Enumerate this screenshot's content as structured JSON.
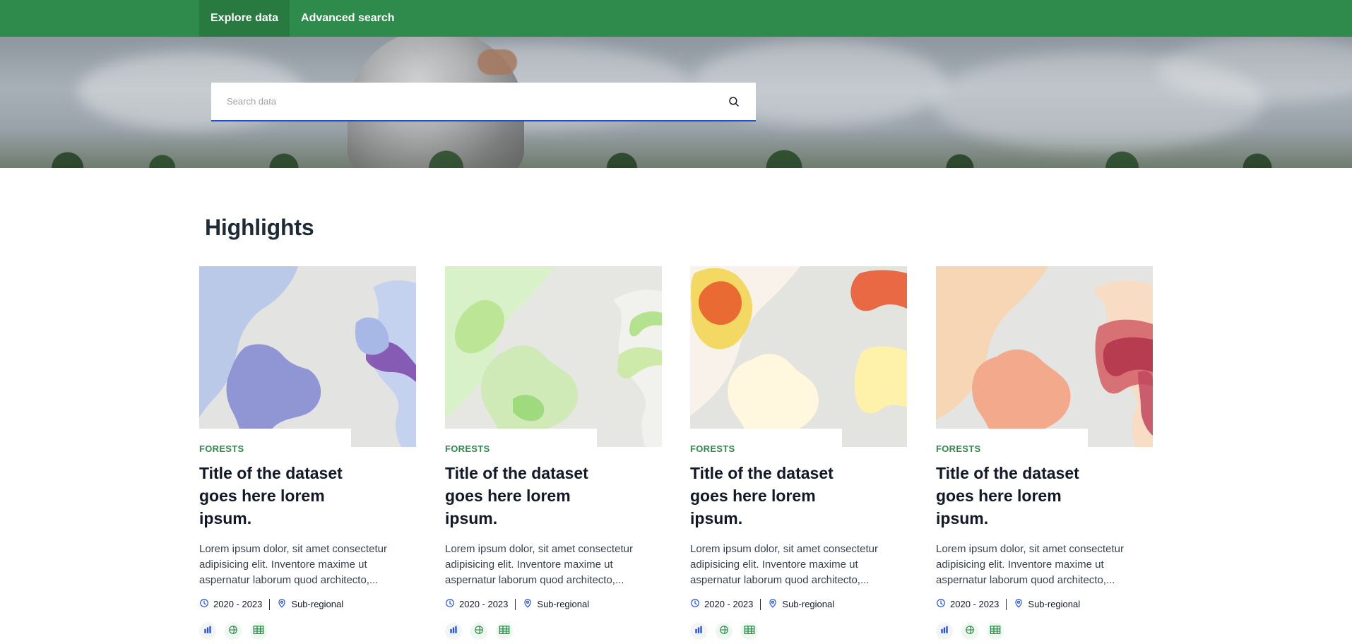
{
  "nav": {
    "items": [
      {
        "label": "Explore data",
        "active": true
      },
      {
        "label": "Advanced search",
        "active": false
      }
    ]
  },
  "search": {
    "placeholder": "Search data"
  },
  "highlights": {
    "title": "Highlights",
    "cards": [
      {
        "category": "FORESTS",
        "title": "Title of the dataset goes here lorem ipsum.",
        "description": "Lorem ipsum dolor, sit amet consectetur adipisicing elit. Inventore maxime ut aspernatur laborum quod architecto,...",
        "period": "2020 - 2023",
        "scope": "Sub-regional",
        "map_style": "blue-purple"
      },
      {
        "category": "FORESTS",
        "title": "Title of the dataset goes here lorem ipsum.",
        "description": "Lorem ipsum dolor, sit amet consectetur adipisicing elit. Inventore maxime ut aspernatur laborum quod architecto,...",
        "period": "2020 - 2023",
        "scope": "Sub-regional",
        "map_style": "green"
      },
      {
        "category": "FORESTS",
        "title": "Title of the dataset goes here lorem ipsum.",
        "description": "Lorem ipsum dolor, sit amet consectetur adipisicing elit. Inventore maxime ut aspernatur laborum quod architecto,...",
        "period": "2020 - 2023",
        "scope": "Sub-regional",
        "map_style": "yellow-red"
      },
      {
        "category": "FORESTS",
        "title": "Title of the dataset goes here lorem ipsum.",
        "description": "Lorem ipsum dolor, sit amet consectetur adipisicing elit. Inventore maxime ut aspernatur laborum quod architecto,...",
        "period": "2020 - 2023",
        "scope": "Sub-regional",
        "map_style": "peach-red"
      }
    ]
  },
  "colors": {
    "brand_green": "#2e8b4b",
    "accent_blue": "#1f4fd6",
    "category_green": "#2f8b4b"
  },
  "icons": {
    "search": "search-icon",
    "time": "clock-icon",
    "location": "location-pin-icon",
    "chart": "bar-chart-icon",
    "globe": "globe-icon",
    "table": "table-icon"
  }
}
